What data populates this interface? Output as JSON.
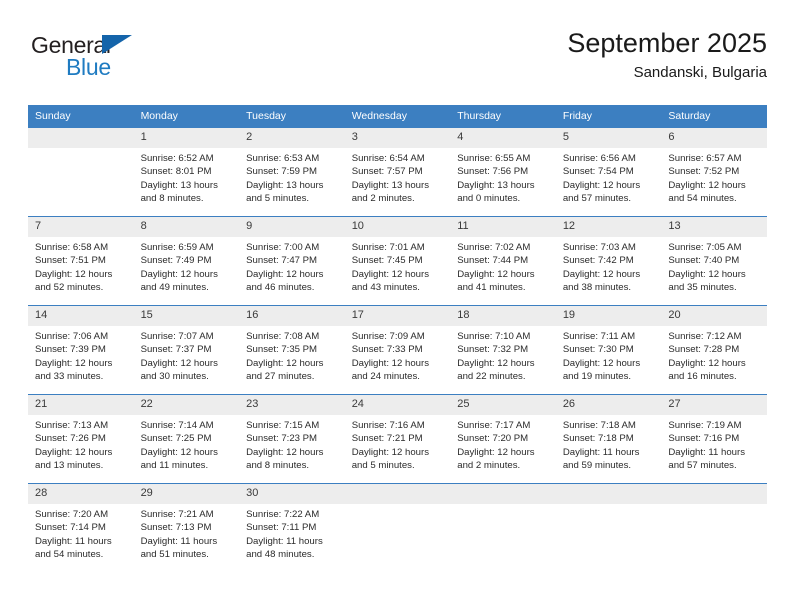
{
  "brand": {
    "name_part1": "General",
    "name_part2": "Blue",
    "triangle_color": "#1464aa",
    "blue_color": "#1f7bc1"
  },
  "header": {
    "title": "September 2025",
    "subtitle": "Sandanski, Bulgaria"
  },
  "theme": {
    "header_bg": "#3c7fc1",
    "daynum_bg": "#ededed",
    "row_border": "#3c7fc1"
  },
  "weekdays": [
    "Sunday",
    "Monday",
    "Tuesday",
    "Wednesday",
    "Thursday",
    "Friday",
    "Saturday"
  ],
  "weeks": [
    [
      {
        "day": "",
        "sunrise": "",
        "sunset": "",
        "daylight": ""
      },
      {
        "day": "1",
        "sunrise": "Sunrise: 6:52 AM",
        "sunset": "Sunset: 8:01 PM",
        "daylight": "Daylight: 13 hours and 8 minutes."
      },
      {
        "day": "2",
        "sunrise": "Sunrise: 6:53 AM",
        "sunset": "Sunset: 7:59 PM",
        "daylight": "Daylight: 13 hours and 5 minutes."
      },
      {
        "day": "3",
        "sunrise": "Sunrise: 6:54 AM",
        "sunset": "Sunset: 7:57 PM",
        "daylight": "Daylight: 13 hours and 2 minutes."
      },
      {
        "day": "4",
        "sunrise": "Sunrise: 6:55 AM",
        "sunset": "Sunset: 7:56 PM",
        "daylight": "Daylight: 13 hours and 0 minutes."
      },
      {
        "day": "5",
        "sunrise": "Sunrise: 6:56 AM",
        "sunset": "Sunset: 7:54 PM",
        "daylight": "Daylight: 12 hours and 57 minutes."
      },
      {
        "day": "6",
        "sunrise": "Sunrise: 6:57 AM",
        "sunset": "Sunset: 7:52 PM",
        "daylight": "Daylight: 12 hours and 54 minutes."
      }
    ],
    [
      {
        "day": "7",
        "sunrise": "Sunrise: 6:58 AM",
        "sunset": "Sunset: 7:51 PM",
        "daylight": "Daylight: 12 hours and 52 minutes."
      },
      {
        "day": "8",
        "sunrise": "Sunrise: 6:59 AM",
        "sunset": "Sunset: 7:49 PM",
        "daylight": "Daylight: 12 hours and 49 minutes."
      },
      {
        "day": "9",
        "sunrise": "Sunrise: 7:00 AM",
        "sunset": "Sunset: 7:47 PM",
        "daylight": "Daylight: 12 hours and 46 minutes."
      },
      {
        "day": "10",
        "sunrise": "Sunrise: 7:01 AM",
        "sunset": "Sunset: 7:45 PM",
        "daylight": "Daylight: 12 hours and 43 minutes."
      },
      {
        "day": "11",
        "sunrise": "Sunrise: 7:02 AM",
        "sunset": "Sunset: 7:44 PM",
        "daylight": "Daylight: 12 hours and 41 minutes."
      },
      {
        "day": "12",
        "sunrise": "Sunrise: 7:03 AM",
        "sunset": "Sunset: 7:42 PM",
        "daylight": "Daylight: 12 hours and 38 minutes."
      },
      {
        "day": "13",
        "sunrise": "Sunrise: 7:05 AM",
        "sunset": "Sunset: 7:40 PM",
        "daylight": "Daylight: 12 hours and 35 minutes."
      }
    ],
    [
      {
        "day": "14",
        "sunrise": "Sunrise: 7:06 AM",
        "sunset": "Sunset: 7:39 PM",
        "daylight": "Daylight: 12 hours and 33 minutes."
      },
      {
        "day": "15",
        "sunrise": "Sunrise: 7:07 AM",
        "sunset": "Sunset: 7:37 PM",
        "daylight": "Daylight: 12 hours and 30 minutes."
      },
      {
        "day": "16",
        "sunrise": "Sunrise: 7:08 AM",
        "sunset": "Sunset: 7:35 PM",
        "daylight": "Daylight: 12 hours and 27 minutes."
      },
      {
        "day": "17",
        "sunrise": "Sunrise: 7:09 AM",
        "sunset": "Sunset: 7:33 PM",
        "daylight": "Daylight: 12 hours and 24 minutes."
      },
      {
        "day": "18",
        "sunrise": "Sunrise: 7:10 AM",
        "sunset": "Sunset: 7:32 PM",
        "daylight": "Daylight: 12 hours and 22 minutes."
      },
      {
        "day": "19",
        "sunrise": "Sunrise: 7:11 AM",
        "sunset": "Sunset: 7:30 PM",
        "daylight": "Daylight: 12 hours and 19 minutes."
      },
      {
        "day": "20",
        "sunrise": "Sunrise: 7:12 AM",
        "sunset": "Sunset: 7:28 PM",
        "daylight": "Daylight: 12 hours and 16 minutes."
      }
    ],
    [
      {
        "day": "21",
        "sunrise": "Sunrise: 7:13 AM",
        "sunset": "Sunset: 7:26 PM",
        "daylight": "Daylight: 12 hours and 13 minutes."
      },
      {
        "day": "22",
        "sunrise": "Sunrise: 7:14 AM",
        "sunset": "Sunset: 7:25 PM",
        "daylight": "Daylight: 12 hours and 11 minutes."
      },
      {
        "day": "23",
        "sunrise": "Sunrise: 7:15 AM",
        "sunset": "Sunset: 7:23 PM",
        "daylight": "Daylight: 12 hours and 8 minutes."
      },
      {
        "day": "24",
        "sunrise": "Sunrise: 7:16 AM",
        "sunset": "Sunset: 7:21 PM",
        "daylight": "Daylight: 12 hours and 5 minutes."
      },
      {
        "day": "25",
        "sunrise": "Sunrise: 7:17 AM",
        "sunset": "Sunset: 7:20 PM",
        "daylight": "Daylight: 12 hours and 2 minutes."
      },
      {
        "day": "26",
        "sunrise": "Sunrise: 7:18 AM",
        "sunset": "Sunset: 7:18 PM",
        "daylight": "Daylight: 11 hours and 59 minutes."
      },
      {
        "day": "27",
        "sunrise": "Sunrise: 7:19 AM",
        "sunset": "Sunset: 7:16 PM",
        "daylight": "Daylight: 11 hours and 57 minutes."
      }
    ],
    [
      {
        "day": "28",
        "sunrise": "Sunrise: 7:20 AM",
        "sunset": "Sunset: 7:14 PM",
        "daylight": "Daylight: 11 hours and 54 minutes."
      },
      {
        "day": "29",
        "sunrise": "Sunrise: 7:21 AM",
        "sunset": "Sunset: 7:13 PM",
        "daylight": "Daylight: 11 hours and 51 minutes."
      },
      {
        "day": "30",
        "sunrise": "Sunrise: 7:22 AM",
        "sunset": "Sunset: 7:11 PM",
        "daylight": "Daylight: 11 hours and 48 minutes."
      },
      {
        "day": "",
        "sunrise": "",
        "sunset": "",
        "daylight": ""
      },
      {
        "day": "",
        "sunrise": "",
        "sunset": "",
        "daylight": ""
      },
      {
        "day": "",
        "sunrise": "",
        "sunset": "",
        "daylight": ""
      },
      {
        "day": "",
        "sunrise": "",
        "sunset": "",
        "daylight": ""
      }
    ]
  ]
}
